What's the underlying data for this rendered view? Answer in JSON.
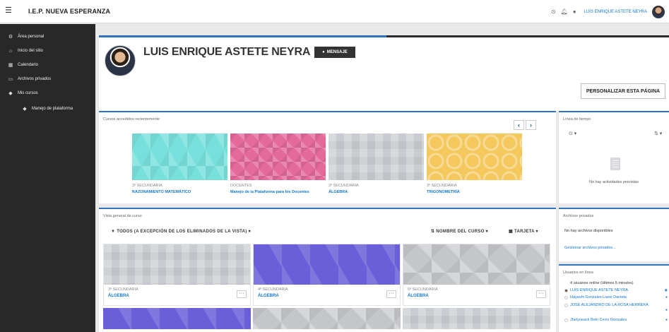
{
  "header": {
    "menu_icon": "hamburger-icon",
    "site_name": "I.E.P. NUEVA ESPERANZA",
    "user_name": "LUIS ENRIQUE ASTETE NEYRA"
  },
  "sidebar": {
    "items": [
      {
        "label": "Área personal",
        "icon": "dashboard-icon"
      },
      {
        "label": "Inicio del sitio",
        "icon": "home-icon"
      },
      {
        "label": "Calendario",
        "icon": "calendar-icon"
      },
      {
        "label": "Archivos privados",
        "icon": "file-icon"
      },
      {
        "label": "Mis cursos",
        "icon": "graduation-cap-icon"
      },
      {
        "label": "Manejo de plataforma",
        "icon": "graduation-cap-icon"
      }
    ]
  },
  "profile": {
    "name": "LUIS ENRIQUE ASTETE NEYRA",
    "message_label": "MENSAJE",
    "customize_label": "PERSONALIZAR ESTA PÁGINA"
  },
  "recent": {
    "title": "Cursos accedidos recientemente",
    "prev": "‹",
    "next": "›",
    "courses": [
      {
        "category": "3º SECUNDARIA",
        "name": "RAZONAMIENTO MATEMÁTICO"
      },
      {
        "category": "DOCENTES",
        "name": "Manejo de la Plataforma para los Docentes"
      },
      {
        "category": "3º SECUNDARIA",
        "name": "ÁLGEBRA"
      },
      {
        "category": "3º SECUNDARIA",
        "name": "TRIGONOMETRÍA"
      }
    ]
  },
  "overview": {
    "title": "Vista general de curso",
    "filter_label": "TODOS (A EXCEPCIÓN DE LOS ELIMINADOS DE LA VISTA)",
    "sort_label": "NOMBRE DEL CURSO",
    "view_label": "TARJETA",
    "courses": [
      {
        "category": "3º SECUNDARIA",
        "name": "ÁLGEBRA",
        "menu": "···"
      },
      {
        "category": "4º SECUNDARIA",
        "name": "ÁLGEBRA",
        "menu": "···"
      },
      {
        "category": "5º SECUNDARIA",
        "name": "ÁLGEBRA",
        "menu": "···"
      }
    ]
  },
  "timeline": {
    "title": "Línea de tiempo",
    "empty": "No hay actividades previstas"
  },
  "files": {
    "title": "Archivos privados",
    "empty": "No hay archivos disponibles",
    "manage": "Gestionar archivos privados..."
  },
  "online": {
    "title": "Usuarios en línea",
    "summary": "4 usuarios online (últimos 5 minutos)",
    "users": [
      "LUIS ENRIQUE ASTETE NEYRA",
      "Hayashi Gonzales Liane Daniela",
      "JOSE ALEJANDRO DE LA ROSA HERRERA",
      "Jhelyneack Bein Cerro Gonzales"
    ]
  }
}
